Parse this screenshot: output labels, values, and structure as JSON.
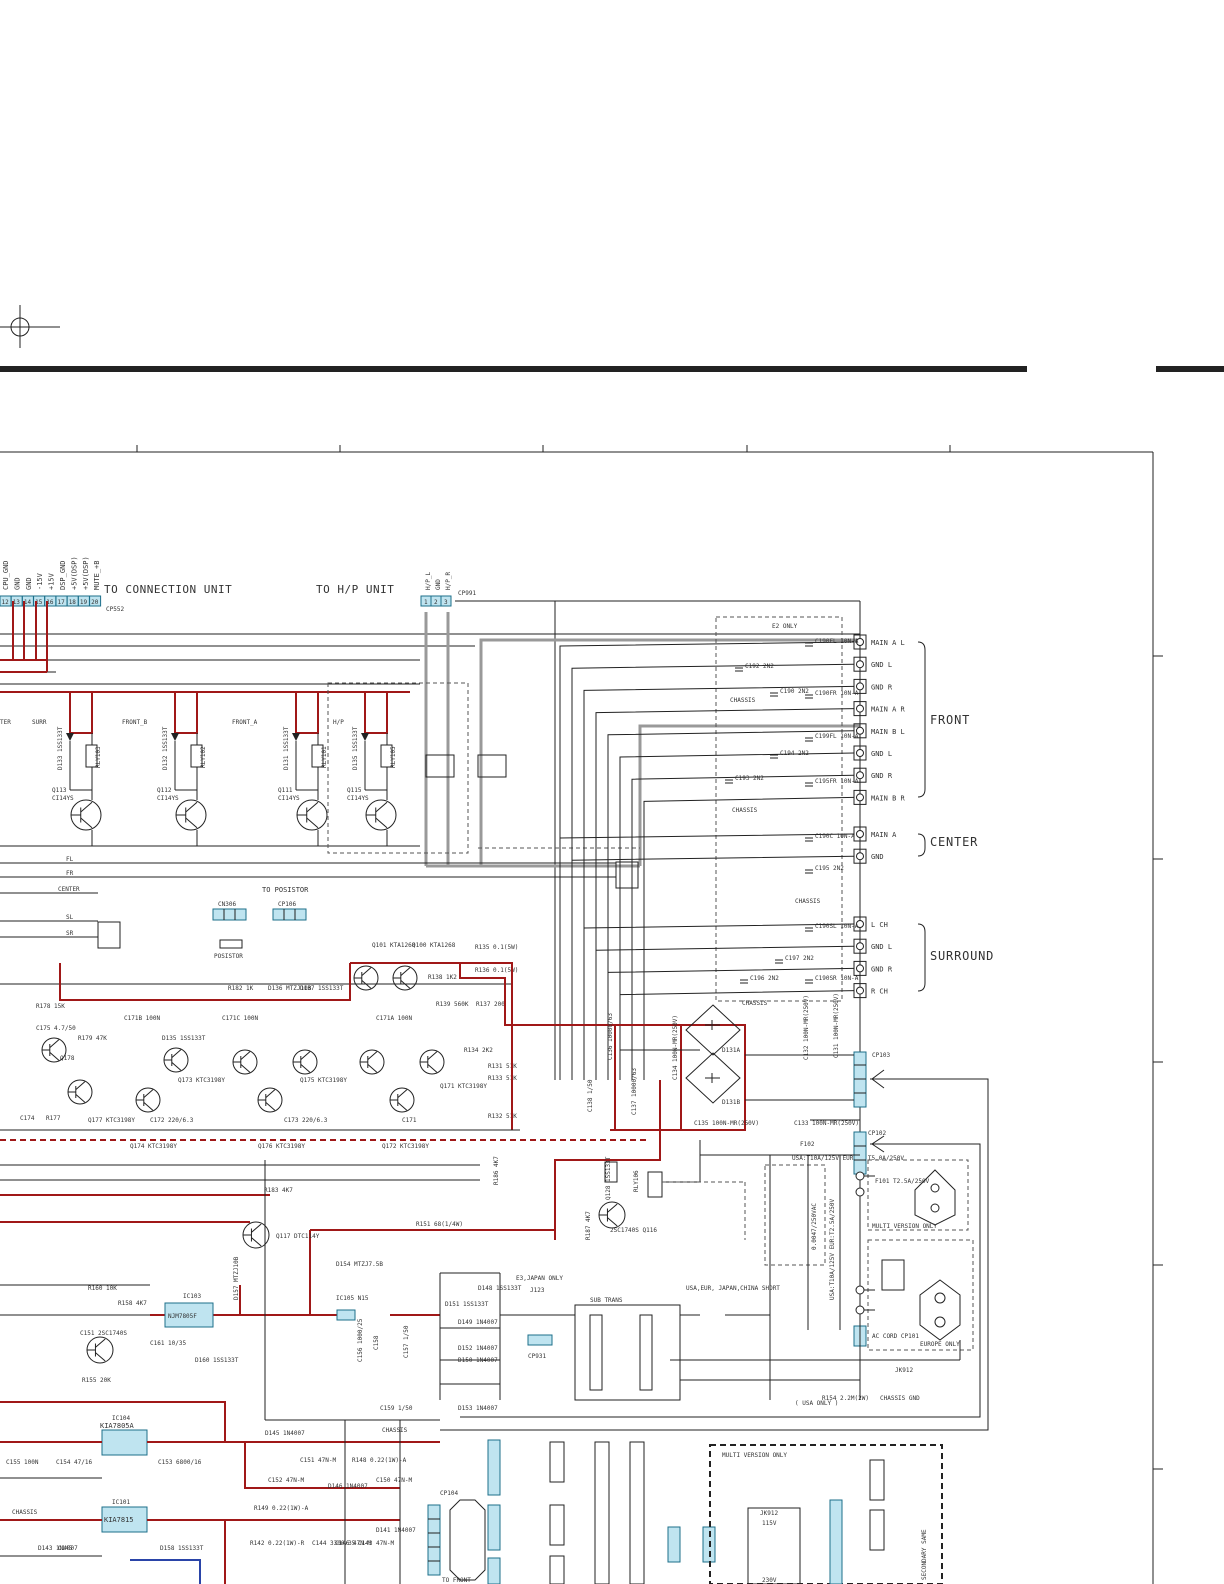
{
  "connector_top": {
    "pin_labels": [
      "CPU_GND",
      "GND",
      "GND",
      "-15V",
      "+15V",
      "DSP_GND",
      "+5V(DSP)",
      "+5V(DSP)",
      "MUTE_+B"
    ],
    "pins": [
      "12",
      "13",
      "14",
      "15",
      "16",
      "17",
      "18",
      "19",
      "20"
    ],
    "name": "CP552",
    "to_label": "TO CONNECTION UNIT"
  },
  "hp_connector": {
    "to_label": "TO H/P UNIT",
    "pin_labels": [
      "H/P_L",
      "GND",
      "H/P_R"
    ],
    "pins": [
      "1",
      "2",
      "3"
    ],
    "name": "CP991"
  },
  "zone_labels": [
    "TER",
    "SURR",
    "FRONT_B",
    "FRONT_A",
    "H/P"
  ],
  "relays": [
    "RLY103",
    "RLY102",
    "RLY101",
    "RLY105"
  ],
  "diodes_relay": [
    "D133 1SS133T",
    "D132 1SS133T",
    "D131 1SS133T",
    "D135 1SS133T"
  ],
  "transistors_relay": [
    {
      "ref": "Q113",
      "part": "CI14YS"
    },
    {
      "ref": "Q112",
      "part": "CI14YS"
    },
    {
      "ref": "Q111",
      "part": "CI14YS"
    },
    {
      "ref": "Q115",
      "part": "CI14YS"
    }
  ],
  "signal_lines": [
    "FL",
    "FR",
    "CENTER",
    "SL",
    "SR"
  ],
  "e2_only": "E2 ONLY",
  "terminals": {
    "front": {
      "group": "FRONT",
      "labels": [
        "MAIN A L",
        "GND L",
        "GND R",
        "MAIN A R",
        "MAIN B L",
        "GND L",
        "GND R",
        "MAIN B R"
      ]
    },
    "center": {
      "group": "CENTER",
      "labels": [
        "MAIN A",
        "GND"
      ]
    },
    "surround": {
      "group": "SURROUND",
      "labels": [
        "L CH",
        "GND L",
        "GND R",
        "R CH"
      ]
    }
  },
  "caps_speaker": [
    "C190FL 10N-A",
    "C192 2N2",
    "C190FR 10N-A",
    "C190 2N2",
    "C199FL 10N-A",
    "C194 2N2",
    "C193 2N2",
    "C195FR 10N-A",
    "C190C 10N-A",
    "C195 2N2",
    "C190SL 10N-A",
    "C197 2N2",
    "C196 2N2",
    "C190SR 10N-A"
  ],
  "chassis": "CHASSIS",
  "posistor": {
    "connector": "CN306",
    "to_label": "TO POSISTOR",
    "cp": "CP106",
    "part": "POSISTOR"
  },
  "protection": [
    "Q101 KTA1268",
    "Q100 KTA1268",
    "R135 0.1(5W)",
    "R136 0.1(5W)",
    "R138 1K2",
    "R139 560K",
    "R137 200",
    "C171A 100N",
    "R134 2K2",
    "R131 51K",
    "R133 51K",
    "R132 51K"
  ],
  "amp_parts": [
    "R178 15K",
    "C175 4.7/50",
    "R179 47K",
    "Q178",
    "R182 1K",
    "D136 MTZJ10B",
    "D137 1SS133T",
    "C171B 100N",
    "D135 1SS133T",
    "C171C 100N",
    "Q173 KTC3198Y",
    "Q175 KTC3198Y",
    "Q171 KTC3198Y",
    "C174",
    "R177",
    "C172 220/6.3",
    "C173 220/6.3",
    "C171",
    "Q174 KTC3198Y",
    "Q176 KTC3198Y",
    "Q172 KTC3198Y",
    "Q177 KTC3198Y"
  ],
  "power": {
    "caps": [
      "C136 10000/63",
      "C137 10000/63",
      "C138 1/50",
      "C134 100N-MR(250V)",
      "C135 100N-MR(250V)",
      "C132 100N-MR(250V)",
      "C131 100N-MR(250V)",
      "C133 100N-MR(250V)"
    ],
    "rectifier": [
      "D131A",
      "D131B"
    ],
    "cp103": "CP103",
    "cp102": "CP102",
    "fuse": "F102",
    "fuse_rating": "USA:T10A/125V EUROPE:T5.0A/250V",
    "f101": "F101 T2.5A/250V",
    "multi_version_only": "MULTI VERSION ONLY",
    "europe_only": "EUROPE ONLY",
    "ac_cord": "AC CORD CP101",
    "jk912": "JK912",
    "r154": "R154 2.2M(2W)",
    "usa_only": "( USA ONLY )",
    "chassis_gnd": "CHASSIS GND",
    "c130_note": "0.0047/250VAC",
    "ue_note": "USA:T10A/125V EUR:T2.5A/250V"
  },
  "standby": {
    "r186": "R186 4K7",
    "r183": "R183 4K7",
    "q128": "Q128 1SS133T",
    "rly": "RLY106",
    "q116": "2SC1740S Q116",
    "r151": "R151 68(1/4W)",
    "r187": "R187 4K7",
    "q117": "Q117 DTC114Y",
    "d154": "D154 MTZJ7.5B",
    "d157": "D157 MTZJ10B",
    "ic105": "IC105 N15",
    "e3_japan": "E3,JAPAN ONLY",
    "j123": "J123",
    "cp931": "CP931",
    "sub_trans": "SUB TRANS",
    "usa_eur_short": "USA,EUR, JAPAN,CHINA SHORT",
    "d148": "D148 1SS133T",
    "d151": "D151 1SS133T",
    "d149": "D149 1N4007",
    "d152": "D152 1N4007",
    "d150": "D150 1N4007",
    "d153": "D153 1N4007",
    "c156": "C156 1000/25",
    "c158": "C158",
    "c157": "C157 1/50",
    "c159": "C159 1/50"
  },
  "regulators": [
    {
      "ref": "IC103",
      "part": "NJM7805F"
    },
    {
      "ref": "IC104",
      "part": "KIA7805A"
    },
    {
      "ref": "IC101",
      "part": "KIA7815"
    }
  ],
  "reg_parts": [
    "R160 10K",
    "R158 4K7",
    "C151 2SC1740S",
    "C161 10/35",
    "D160 1SS133T",
    "R155 20K",
    "C155 100N",
    "C154 47/16",
    "C153 6800/16",
    "D145 1N4007",
    "C151 47N-M",
    "C152 47N-M",
    "R148 0.22(1W)-A",
    "D146 1N4007",
    "C150 47N-M",
    "R149 0.22(1W)-A",
    "D141 1N4007",
    "R142 0.22(1W)-R",
    "D143 1N4007",
    "C145",
    "D158 1SS133T",
    "C144 3300/35",
    "C143 47N-M",
    "C146 47N-M"
  ],
  "bottom": {
    "cp104": "CP104",
    "to_front": "TO FRONT",
    "multi_version_only": "MULTI VERSION ONLY",
    "jk912": "JK912",
    "v115": "115V",
    "v230": "230V",
    "secondary_same": "SECONDARY SAME"
  }
}
